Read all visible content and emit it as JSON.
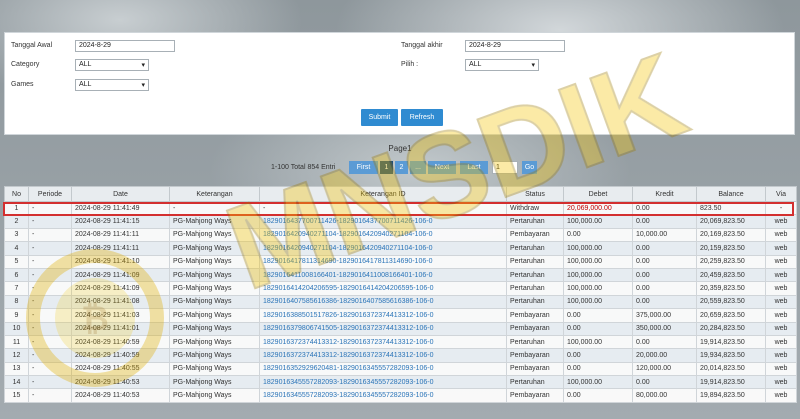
{
  "filters": {
    "tanggal_awal_label": "Tanggal Awal",
    "tanggal_awal_value": "2024-8-29",
    "tanggal_akhir_label": "Tanggal akhir",
    "tanggal_akhir_value": "2024-8-29",
    "category_label": "Category",
    "category_value": "ALL",
    "pilih_label": "Pilih :",
    "pilih_value": "ALL",
    "games_label": "Games",
    "games_value": "ALL",
    "submit_label": "Submit",
    "refresh_label": "Refresh"
  },
  "pagination": {
    "page_label": "Page1",
    "total_text": "1-100 Total 854 Entri",
    "first_label": "First",
    "pages": [
      "1",
      "2",
      "..."
    ],
    "next_label": "Next",
    "last_label": "Last",
    "page_input_value": "1",
    "go_label": "Go"
  },
  "table": {
    "headers": [
      "No",
      "Periode",
      "Date",
      "Keterangan",
      "Keterangan ID",
      "Status",
      "Debet",
      "Kredit",
      "Balance",
      "Via"
    ],
    "rows": [
      [
        "1",
        "-",
        "2024-08-29 11:41:49",
        "-",
        "-",
        "Withdraw",
        "20,069,000.00",
        "0.00",
        "823.50",
        "-"
      ],
      [
        "2",
        "-",
        "2024-08-29 11:41:15",
        "PG-Mahjong Ways",
        "1829016437700711426-1829016437700711426-106-0",
        "Pertaruhan",
        "100,000.00",
        "0.00",
        "20,069,823.50",
        "web"
      ],
      [
        "3",
        "-",
        "2024-08-29 11:41:11",
        "PG-Mahjong Ways",
        "1829016420940271104-1829016420940271104-106-0",
        "Pembayaran",
        "0.00",
        "10,000.00",
        "20,169,823.50",
        "web"
      ],
      [
        "4",
        "-",
        "2024-08-29 11:41:11",
        "PG-Mahjong Ways",
        "1829016420940271104-1829016420940271104-106-0",
        "Pertaruhan",
        "100,000.00",
        "0.00",
        "20,159,823.50",
        "web"
      ],
      [
        "5",
        "-",
        "2024-08-29 11:41:10",
        "PG-Mahjong Ways",
        "1829016417811314690-1829016417811314690-106-0",
        "Pertaruhan",
        "100,000.00",
        "0.00",
        "20,259,823.50",
        "web"
      ],
      [
        "6",
        "-",
        "2024-08-29 11:41:09",
        "PG-Mahjong Ways",
        "1829016411008166401-1829016411008166401-106-0",
        "Pertaruhan",
        "100,000.00",
        "0.00",
        "20,459,823.50",
        "web"
      ],
      [
        "7",
        "-",
        "2024-08-29 11:41:09",
        "PG-Mahjong Ways",
        "1829016414204206595-1829016414204206595-106-0",
        "Pertaruhan",
        "100,000.00",
        "0.00",
        "20,359,823.50",
        "web"
      ],
      [
        "8",
        "-",
        "2024-08-29 11:41:08",
        "PG-Mahjong Ways",
        "1829016407585616386-1829016407585616386-106-0",
        "Pertaruhan",
        "100,000.00",
        "0.00",
        "20,559,823.50",
        "web"
      ],
      [
        "9",
        "-",
        "2024-08-29 11:41:03",
        "PG-Mahjong Ways",
        "1829016388501517826-1829016372374413312-106-0",
        "Pembayaran",
        "0.00",
        "375,000.00",
        "20,659,823.50",
        "web"
      ],
      [
        "10",
        "-",
        "2024-08-29 11:41:01",
        "PG-Mahjong Ways",
        "1829016379806741505-1829016372374413312-106-0",
        "Pembayaran",
        "0.00",
        "350,000.00",
        "20,284,823.50",
        "web"
      ],
      [
        "11",
        "-",
        "2024-08-29 11:40:59",
        "PG-Mahjong Ways",
        "1829016372374413312-1829016372374413312-106-0",
        "Pertaruhan",
        "100,000.00",
        "0.00",
        "19,914,823.50",
        "web"
      ],
      [
        "12",
        "-",
        "2024-08-29 11:40:59",
        "PG-Mahjong Ways",
        "1829016372374413312-1829016372374413312-106-0",
        "Pembayaran",
        "0.00",
        "20,000.00",
        "19,934,823.50",
        "web"
      ],
      [
        "13",
        "-",
        "2024-08-29 11:40:55",
        "PG-Mahjong Ways",
        "1829016352929620481-1829016345557282093-106-0",
        "Pembayaran",
        "0.00",
        "120,000.00",
        "20,014,823.50",
        "web"
      ],
      [
        "14",
        "-",
        "2024-08-29 11:40:53",
        "PG-Mahjong Ways",
        "1829016345557282093-1829016345557282093-106-0",
        "Pertaruhan",
        "100,000.00",
        "0.00",
        "19,914,823.50",
        "web"
      ],
      [
        "15",
        "-",
        "2024-08-29 11:40:53",
        "PG-Mahjong Ways",
        "1829016345557282093-1829016345557282093-106-0",
        "Pembayaran",
        "0.00",
        "80,000.00",
        "19,894,823.50",
        "web"
      ]
    ]
  },
  "watermark": {
    "text": "MNSDIK"
  },
  "colors": {
    "accent": "#2f8bd1",
    "highlight_border": "#d32f2f",
    "debet_negative": "#c00000",
    "link": "#2a74b8"
  }
}
